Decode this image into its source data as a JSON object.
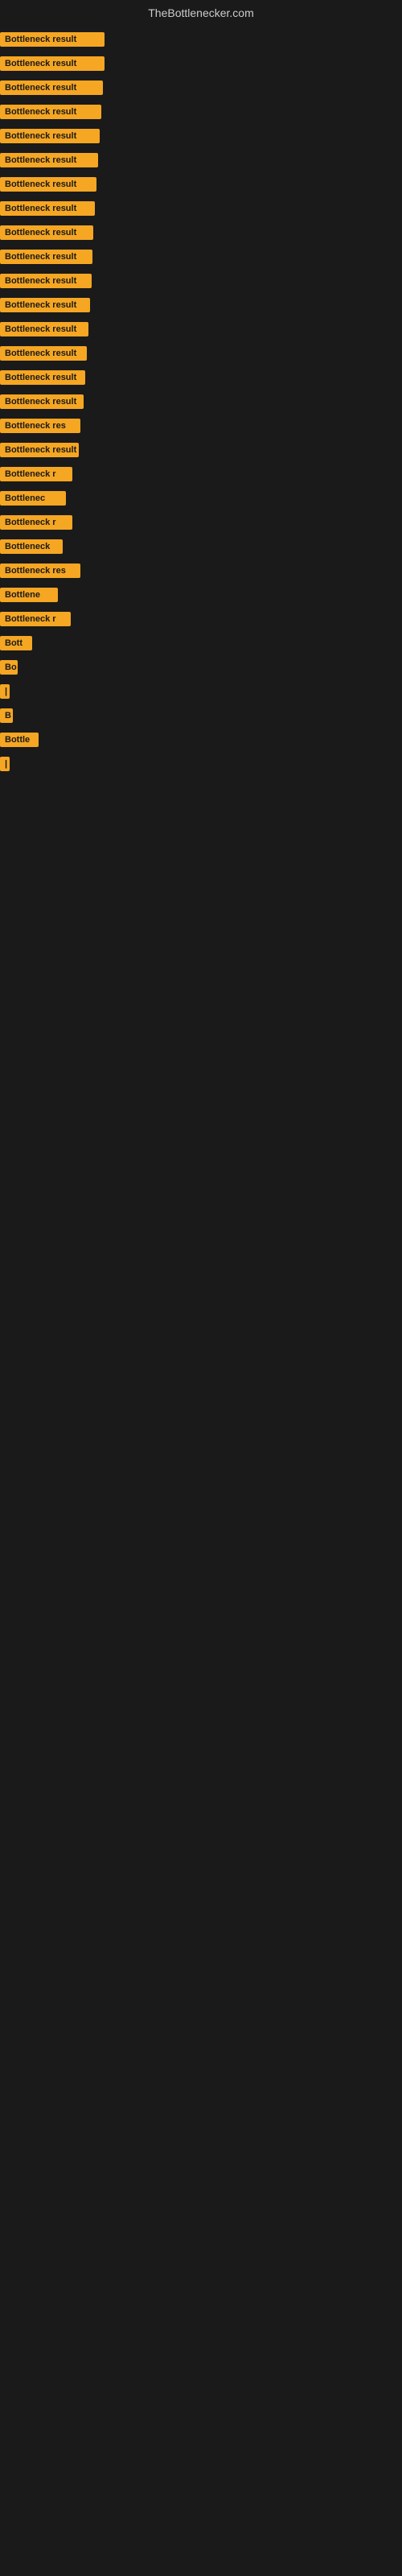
{
  "site": {
    "title": "TheBottlenecker.com"
  },
  "items": [
    {
      "label": "Bottleneck result",
      "width": 130
    },
    {
      "label": "Bottleneck result",
      "width": 130
    },
    {
      "label": "Bottleneck result",
      "width": 128
    },
    {
      "label": "Bottleneck result",
      "width": 126
    },
    {
      "label": "Bottleneck result",
      "width": 124
    },
    {
      "label": "Bottleneck result",
      "width": 122
    },
    {
      "label": "Bottleneck result",
      "width": 120
    },
    {
      "label": "Bottleneck result",
      "width": 118
    },
    {
      "label": "Bottleneck result",
      "width": 116
    },
    {
      "label": "Bottleneck result",
      "width": 115
    },
    {
      "label": "Bottleneck result",
      "width": 114
    },
    {
      "label": "Bottleneck result",
      "width": 112
    },
    {
      "label": "Bottleneck result",
      "width": 110
    },
    {
      "label": "Bottleneck result",
      "width": 108
    },
    {
      "label": "Bottleneck result",
      "width": 106
    },
    {
      "label": "Bottleneck result",
      "width": 104
    },
    {
      "label": "Bottleneck res",
      "width": 100
    },
    {
      "label": "Bottleneck result",
      "width": 98
    },
    {
      "label": "Bottleneck r",
      "width": 90
    },
    {
      "label": "Bottlenec",
      "width": 82
    },
    {
      "label": "Bottleneck r",
      "width": 90
    },
    {
      "label": "Bottleneck",
      "width": 78
    },
    {
      "label": "Bottleneck res",
      "width": 100
    },
    {
      "label": "Bottlene",
      "width": 72
    },
    {
      "label": "Bottleneck r",
      "width": 88
    },
    {
      "label": "Bott",
      "width": 40
    },
    {
      "label": "Bo",
      "width": 22
    },
    {
      "label": "|",
      "width": 8
    },
    {
      "label": "B",
      "width": 16
    },
    {
      "label": "Bottle",
      "width": 48
    },
    {
      "label": "|",
      "width": 8
    }
  ]
}
